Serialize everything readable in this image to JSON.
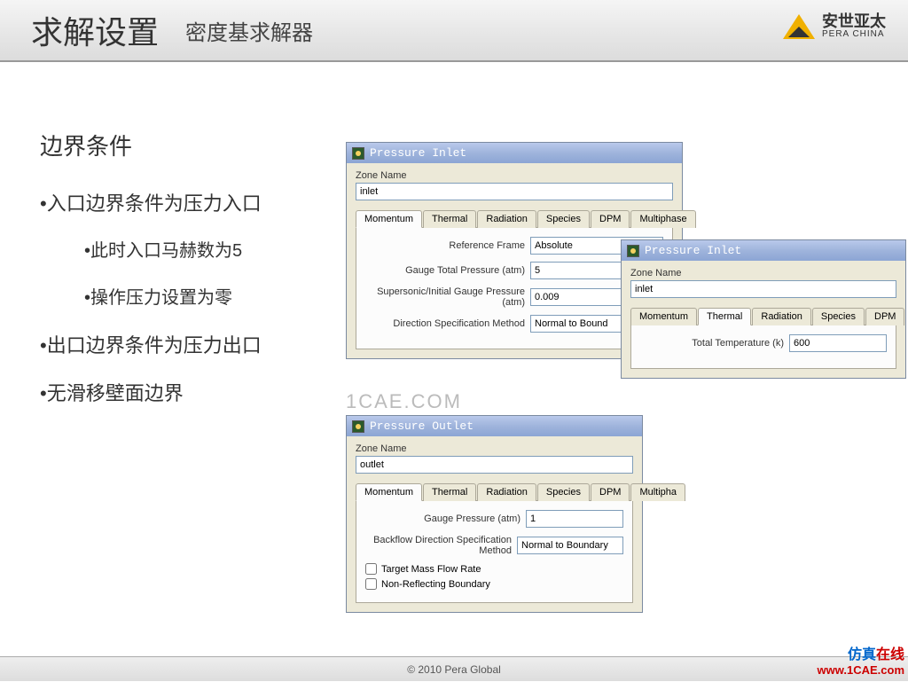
{
  "header": {
    "title": "求解设置",
    "subtitle": "密度基求解器",
    "brand_cn": "安世亚太",
    "brand_en": "PERA CHINA"
  },
  "left": {
    "section": "边界条件",
    "b1": "•入口边界条件为压力入口",
    "b1a": "•此时入口马赫数为5",
    "b1b": "•操作压力设置为零",
    "b2": "•出口边界条件为压力出口",
    "b3": "•无滑移壁面边界"
  },
  "d1": {
    "title": "Pressure Inlet",
    "zone_label": "Zone Name",
    "zone_value": "inlet",
    "tabs": {
      "momentum": "Momentum",
      "thermal": "Thermal",
      "radiation": "Radiation",
      "species": "Species",
      "dpm": "DPM",
      "multiphase": "Multiphase"
    },
    "rows": {
      "ref_label": "Reference Frame",
      "ref_value": "Absolute",
      "gtp_label": "Gauge Total Pressure (atm)",
      "gtp_value": "5",
      "sig_label": "Supersonic/Initial Gauge Pressure (atm)",
      "sig_value": "0.009",
      "dsm_label": "Direction Specification Method",
      "dsm_value": "Normal to Bound"
    }
  },
  "d2": {
    "title": "Pressure Inlet",
    "zone_label": "Zone Name",
    "zone_value": "inlet",
    "tabs": {
      "momentum": "Momentum",
      "thermal": "Thermal",
      "radiation": "Radiation",
      "species": "Species",
      "dpm": "DPM"
    },
    "rows": {
      "tt_label": "Total Temperature (k)",
      "tt_value": "600"
    }
  },
  "d3": {
    "title": "Pressure Outlet",
    "zone_label": "Zone Name",
    "zone_value": "outlet",
    "tabs": {
      "momentum": "Momentum",
      "thermal": "Thermal",
      "radiation": "Radiation",
      "species": "Species",
      "dpm": "DPM",
      "multiphase": "Multipha"
    },
    "rows": {
      "gp_label": "Gauge Pressure (atm)",
      "gp_value": "1",
      "bdsm_label": "Backflow Direction Specification Method",
      "bdsm_value": "Normal to Boundary",
      "chk1": "Target Mass Flow Rate",
      "chk2": "Non-Reflecting Boundary"
    }
  },
  "watermark": "1CAE.COM",
  "footer": "© 2010 Pera Global",
  "corner": {
    "cn_b": "仿真",
    "cn_r": "在线",
    "url": "www.1CAE.com"
  }
}
